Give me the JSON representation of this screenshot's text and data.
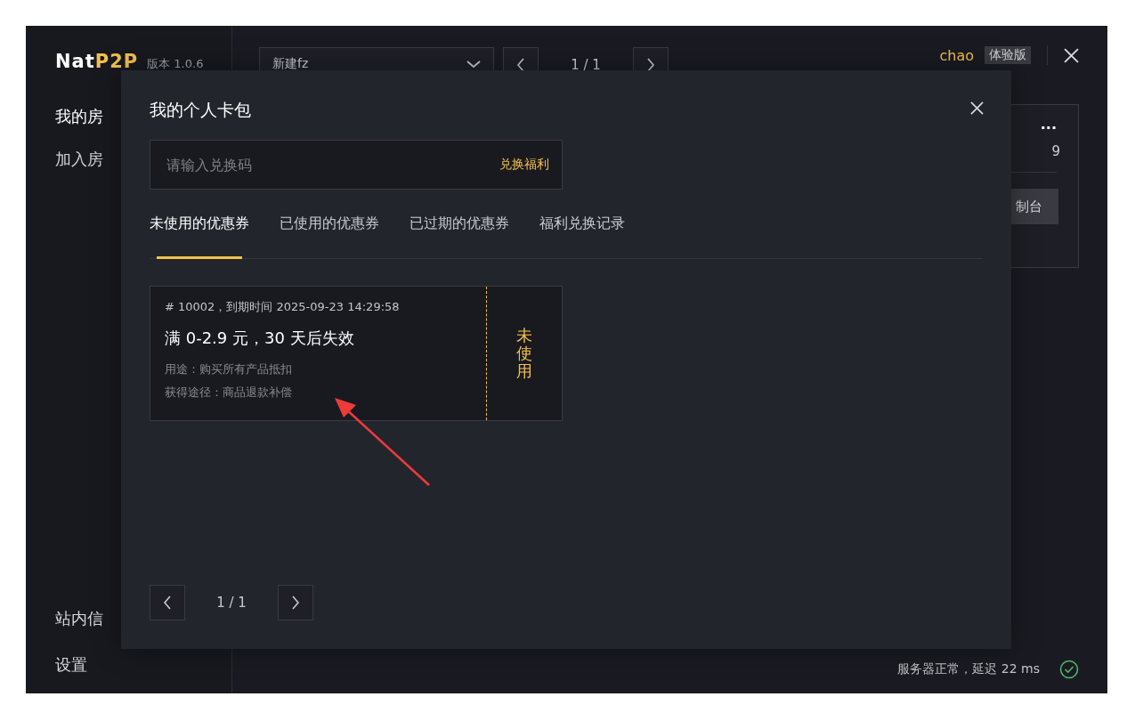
{
  "app": {
    "logo_plain": "Nat",
    "logo_accent": "P2P",
    "version": "版本 1.0.6"
  },
  "sidebar": {
    "items": [
      {
        "label": "我的房",
        "selected": true
      },
      {
        "label": "加入房",
        "selected": false
      }
    ],
    "bottom_items": [
      {
        "label": "站内信"
      },
      {
        "label": "设置"
      }
    ]
  },
  "topbar": {
    "room_select": "新建fz",
    "pager": "1 / 1",
    "user": "chao",
    "plan_badge": "体验版"
  },
  "room_card": {
    "menu": "···",
    "text_fragment": "9",
    "button_fragment": "制台"
  },
  "status_bar": {
    "text": "服务器正常，延迟 22 ms",
    "ok": true
  },
  "modal": {
    "title": "我的个人卡包",
    "redeem": {
      "placeholder": "请输入兑换码",
      "button": "兑换福利"
    },
    "tabs": [
      {
        "label": "未使用的优惠券",
        "selected": true
      },
      {
        "label": "已使用的优惠券",
        "selected": false
      },
      {
        "label": "已过期的优惠券",
        "selected": false
      },
      {
        "label": "福利兑换记录",
        "selected": false
      }
    ],
    "coupons": [
      {
        "header": "# 10002，到期时间 2025-09-23 14:29:58",
        "title": "满 0-2.9 元，30 天后失效",
        "usage": "用途：购买所有产品抵扣",
        "source": "获得途径：商品退款补偿",
        "status": "未使用"
      }
    ],
    "pager": "1 / 1"
  }
}
